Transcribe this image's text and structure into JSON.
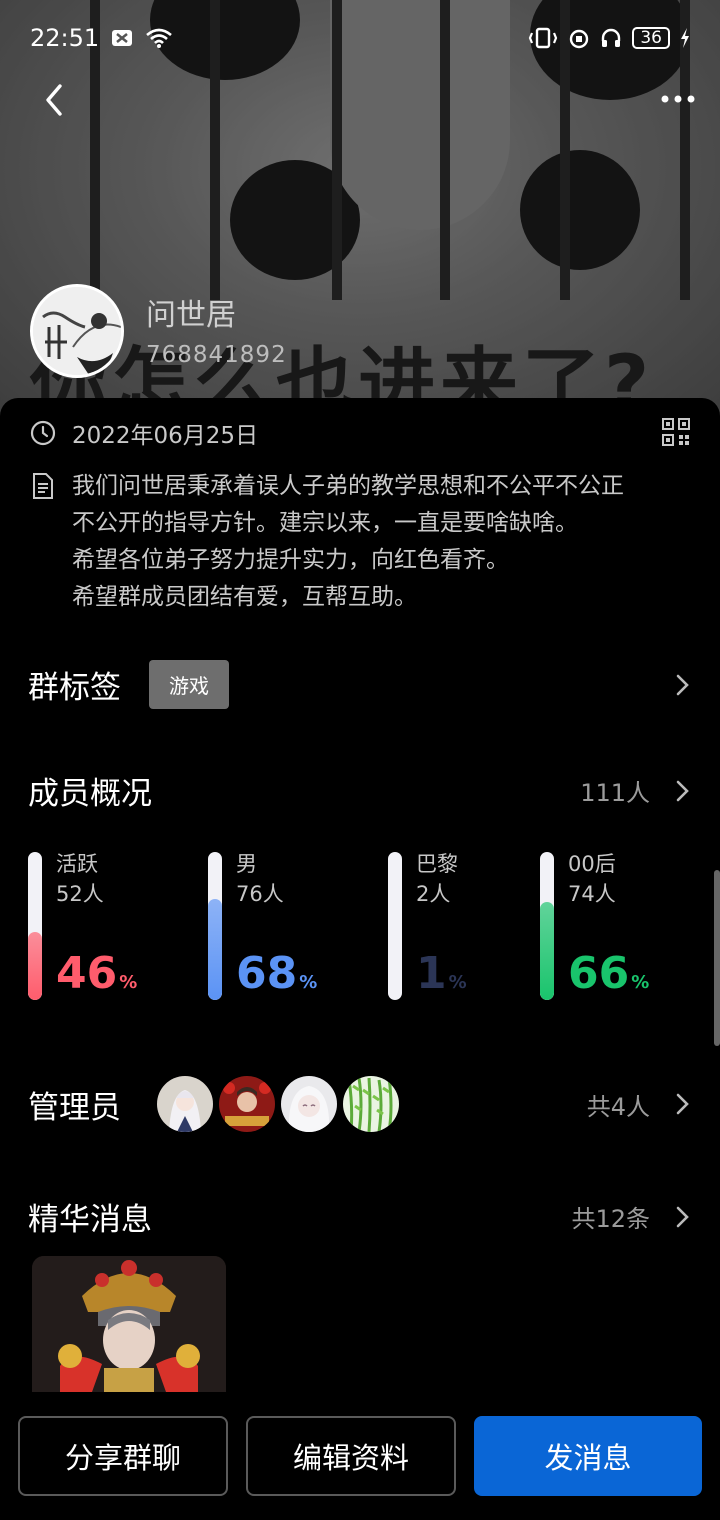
{
  "status_bar": {
    "time": "22:51",
    "battery": "36"
  },
  "header": {
    "cover_text": "你怎么也进来了?",
    "group_name": "问世居",
    "group_id": "768841892"
  },
  "info": {
    "created_date": "2022年06月25日",
    "description_lines": [
      "我们问世居秉承着误人子弟的教学思想和不公平不公正",
      "不公开的指导方针。建宗以来，一直是要啥缺啥。",
      "希望各位弟子努力提升实力，向红色看齐。",
      "希望群成员团结有爱，互帮互助。"
    ]
  },
  "tags": {
    "title": "群标签",
    "tag": "游戏"
  },
  "members": {
    "title": "成员概况",
    "total": "111人",
    "stats": [
      {
        "label": "活跃",
        "count": "52人",
        "percent": 46,
        "pct_text": "46",
        "unit": "%",
        "color": "#ff5c6c"
      },
      {
        "label": "男",
        "count": "76人",
        "percent": 68,
        "pct_text": "68",
        "unit": "%",
        "color": "#5b93f5"
      },
      {
        "label": "巴黎",
        "count": "2人",
        "percent": 1,
        "pct_text": "1",
        "unit": "%",
        "color": "#2b3556"
      },
      {
        "label": "00后",
        "count": "74人",
        "percent": 66,
        "pct_text": "66",
        "unit": "%",
        "color": "#19c46c"
      }
    ]
  },
  "admins": {
    "title": "管理员",
    "count": "共4人"
  },
  "essence": {
    "title": "精华消息",
    "count": "共12条"
  },
  "buttons": {
    "share": "分享群聊",
    "edit": "编辑资料",
    "send": "发消息"
  }
}
